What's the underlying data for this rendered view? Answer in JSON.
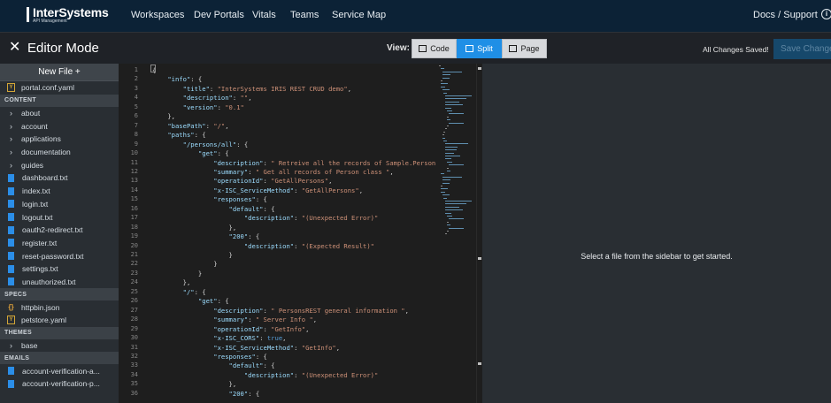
{
  "topnav": {
    "brand": "InterSystems",
    "brand_sub": "API Management",
    "links": [
      "Workspaces",
      "Dev Portals",
      "Vitals",
      "Teams",
      "Service Map"
    ],
    "docs_label": "Docs / Support",
    "info_icon": "i"
  },
  "editor": {
    "close_icon": "✕",
    "title": "Editor Mode",
    "view_label": "View:",
    "views": [
      {
        "label": "Code",
        "icon": "code-icon",
        "active": false
      },
      {
        "label": "Split",
        "icon": "split-icon",
        "active": true
      },
      {
        "label": "Page",
        "icon": "page-icon",
        "active": false
      }
    ],
    "saved_status": "All Changes Saved!",
    "save_label": "Save Changes"
  },
  "sidebar": {
    "new_file_label": "New File +",
    "top_files": [
      {
        "label": "portal.conf.yaml",
        "icon": "yaml-icon"
      }
    ],
    "sections": [
      {
        "title": "CONTENT",
        "items": [
          {
            "label": "about",
            "icon": "chevron-right-icon"
          },
          {
            "label": "account",
            "icon": "chevron-right-icon"
          },
          {
            "label": "applications",
            "icon": "chevron-right-icon"
          },
          {
            "label": "documentation",
            "icon": "chevron-right-icon"
          },
          {
            "label": "guides",
            "icon": "chevron-right-icon"
          },
          {
            "label": "dashboard.txt",
            "icon": "file-icon"
          },
          {
            "label": "index.txt",
            "icon": "file-icon"
          },
          {
            "label": "login.txt",
            "icon": "file-icon"
          },
          {
            "label": "logout.txt",
            "icon": "file-icon"
          },
          {
            "label": "oauth2-redirect.txt",
            "icon": "file-icon"
          },
          {
            "label": "register.txt",
            "icon": "file-icon"
          },
          {
            "label": "reset-password.txt",
            "icon": "file-icon"
          },
          {
            "label": "settings.txt",
            "icon": "file-icon"
          },
          {
            "label": "unauthorized.txt",
            "icon": "file-icon"
          }
        ]
      },
      {
        "title": "SPECS",
        "items": [
          {
            "label": "httpbin.json",
            "icon": "json-icon"
          },
          {
            "label": "petstore.yaml",
            "icon": "yaml-icon"
          }
        ]
      },
      {
        "title": "THEMES",
        "items": [
          {
            "label": "base",
            "icon": "chevron-right-icon"
          }
        ]
      },
      {
        "title": "EMAILS",
        "items": [
          {
            "label": "account-verification-a...",
            "icon": "file-icon"
          },
          {
            "label": "account-verification-p...",
            "icon": "file-icon"
          }
        ]
      }
    ]
  },
  "code": {
    "lines": [
      "{",
      "    \"info\": {",
      "        \"title\": \"InterSystems IRIS REST CRUD demo\",",
      "        \"description\": \"\",",
      "        \"version\": \"0.1\"",
      "    },",
      "    \"basePath\": \"/\",",
      "    \"paths\": {",
      "        \"/persons/all\": {",
      "            \"get\": {",
      "                \"description\": \" Retreive all the records of Sample.Person \"",
      "                \"summary\": \" Get all records of Person class \",",
      "                \"operationId\": \"GetAllPersons\",",
      "                \"x-ISC_ServiceMethod\": \"GetAllPersons\",",
      "                \"responses\": {",
      "                    \"default\": {",
      "                        \"description\": \"(Unexpected Error)\"",
      "                    },",
      "                    \"200\": {",
      "                        \"description\": \"(Expected Result)\"",
      "                    }",
      "                }",
      "            }",
      "        },",
      "        \"/\": {",
      "            \"get\": {",
      "                \"description\": \" PersonsREST general information \",",
      "                \"summary\": \" Server Info \",",
      "                \"operationId\": \"GetInfo\",",
      "                \"x-ISC_CORS\": true,",
      "                \"x-ISC_ServiceMethod\": \"GetInfo\",",
      "                \"responses\": {",
      "                    \"default\": {",
      "                        \"description\": \"(Unexpected Error)\"",
      "                    },",
      "                    \"200\": {"
    ],
    "line_numbers": [
      "1",
      "2",
      "3",
      "4",
      "5",
      "6",
      "7",
      "8",
      "9",
      "10",
      "11",
      "12",
      "13",
      "14",
      "15",
      "16",
      "17",
      "18",
      "19",
      "20",
      "21",
      "22",
      "23",
      "24",
      "25",
      "26",
      "27",
      "28",
      "29",
      "30",
      "31",
      "32",
      "33",
      "34",
      "35",
      "36"
    ]
  },
  "preview": {
    "message": "Select a file from the sidebar to get started."
  },
  "colors": {
    "topnav_bg": "#0c2236",
    "editorbar_bg": "#1f2227",
    "sidebar_bg": "#292e33",
    "active_view": "#1f8fe6",
    "code_bg": "#1e1e1e",
    "file_icon": "#2b8ee8",
    "yaml_icon": "#d3a637",
    "string_token": "#ce9178",
    "key_token": "#9cdcfe"
  }
}
